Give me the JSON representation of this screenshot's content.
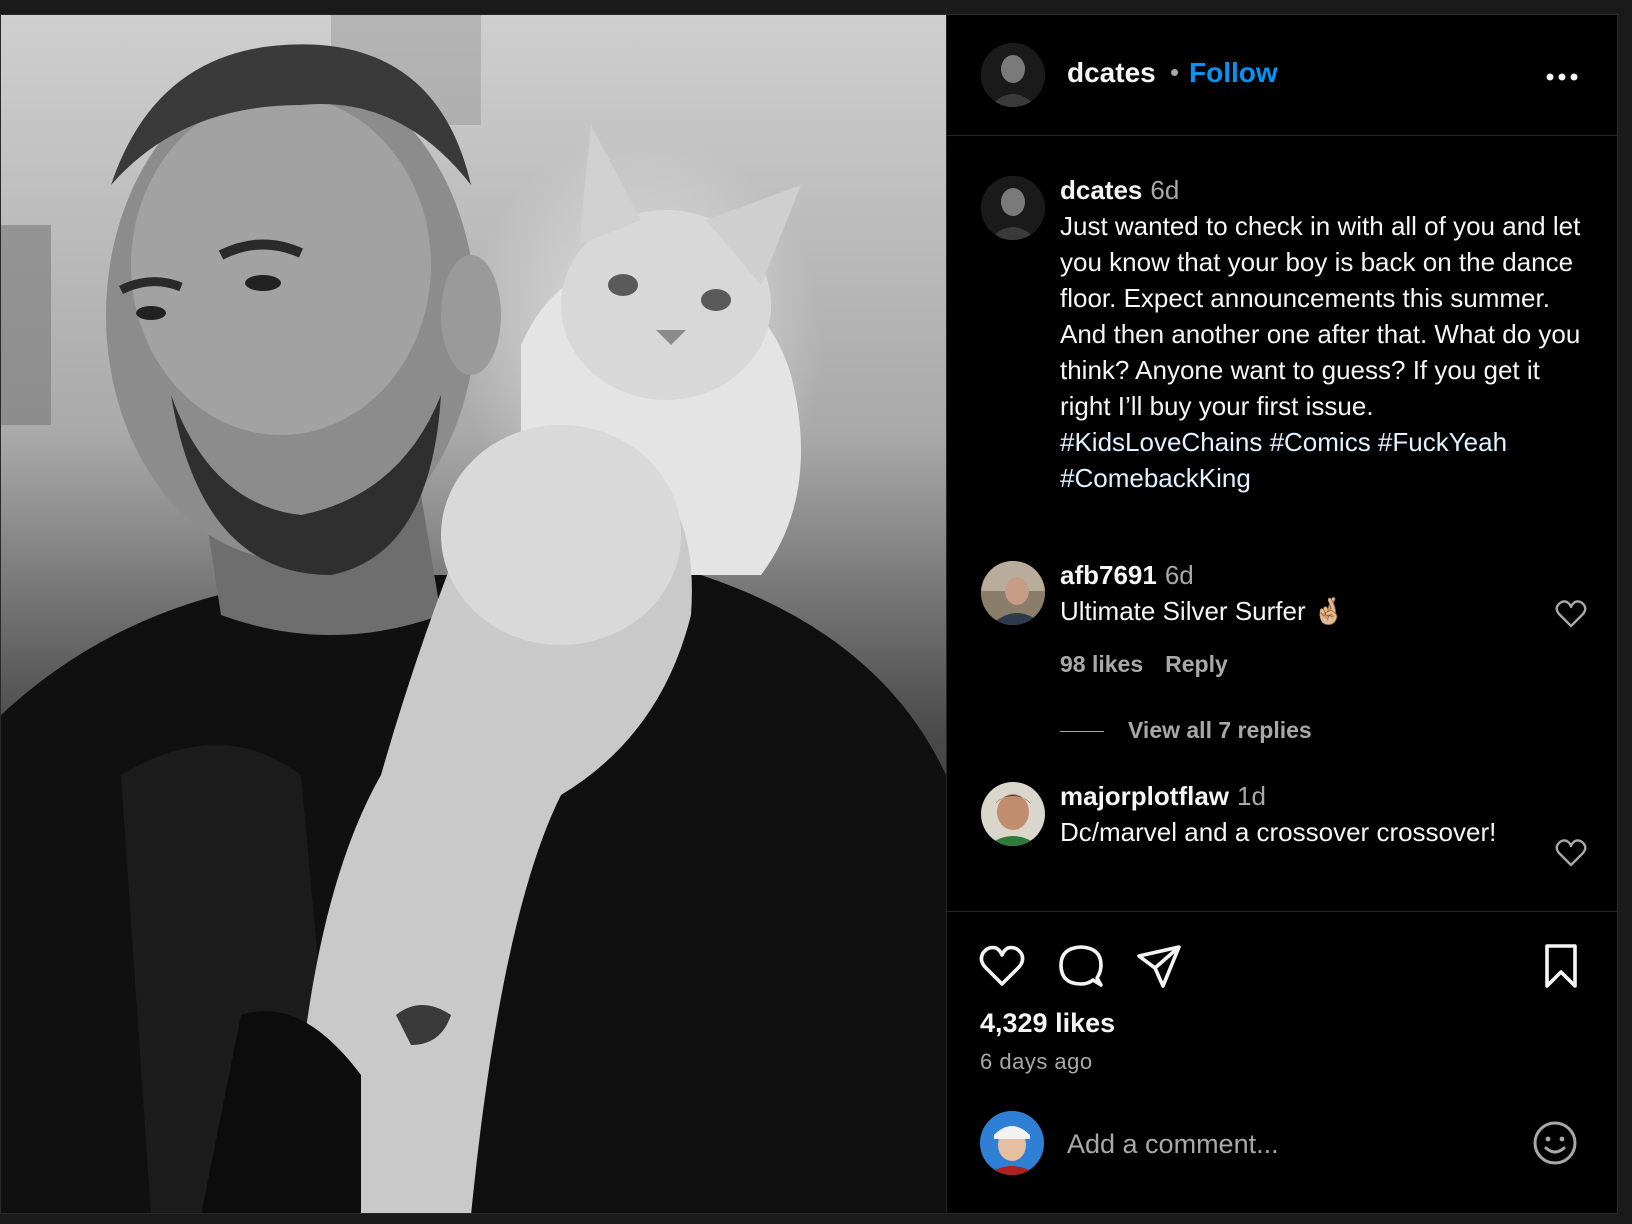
{
  "post": {
    "author": "dcates",
    "follow_label": "Follow",
    "more_icon": "more-options-icon",
    "caption": {
      "username": "dcates",
      "age": "6d",
      "text": "Just wanted to check in with all of you and let you know that your boy is back on the dance floor. Expect announcements this summer. And then another one after that. What do you think? Anyone want to guess? If you get it right I’ll buy your first issue.",
      "hashtags": "#KidsLoveChains #Comics #FuckYeah #ComebackKing"
    },
    "comments": [
      {
        "username": "afb7691",
        "age": "6d",
        "text": "Ultimate Silver Surfer 🤞🏼",
        "likes": "98 likes",
        "reply_label": "Reply",
        "view_replies": "View all 7 replies"
      },
      {
        "username": "majorplotflaw",
        "age": "1d",
        "text": "Dc/marvel and a crossover crossover!"
      }
    ],
    "likes_count": "4,329 likes",
    "posted_ago": "6 days ago",
    "add_comment_placeholder": "Add a comment...",
    "colors": {
      "accent": "#0095f6",
      "background": "#000000",
      "muted": "#a8a8a8"
    }
  }
}
